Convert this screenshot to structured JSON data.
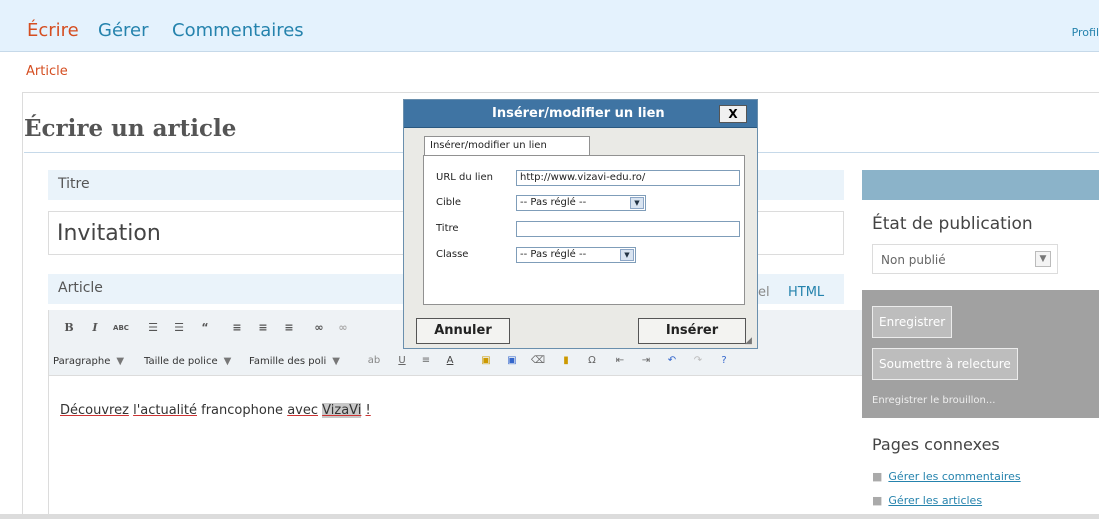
{
  "nav": {
    "tabs": [
      "Écrire",
      "Gérer",
      "Commentaires"
    ],
    "profile_label": "Profil",
    "sub_tab": "Article"
  },
  "page": {
    "title": "Écrire un article"
  },
  "post": {
    "title_label": "Titre",
    "title_value": "Invitation",
    "content_label": "Article",
    "visual_tab_partial": "el",
    "html_tab": "HTML",
    "toolbar": {
      "format_select": "Paragraphe",
      "font_size_select": "Taille de police",
      "font_family_select": "Famille des poli"
    },
    "content": {
      "w1": "Découvrez",
      "w2": "l'actualité",
      "w3": "francophone",
      "w4": "avec",
      "w5": "VizaVi",
      "w6": "!"
    }
  },
  "sidebar": {
    "publish_title": "État de publication",
    "status_select": "Non publié",
    "save_button": "Enregistrer",
    "submit_button": "Soumettre à relecture",
    "draft_text": "Enregistrer le brouillon...",
    "related_title": "Pages connexes",
    "related_links": [
      "Gérer les commentaires",
      "Gérer les articles"
    ]
  },
  "dialog": {
    "title": "Insérer/modifier un lien",
    "close": "X",
    "tab": "Insérer/modifier un lien",
    "url_label": "URL du lien",
    "url_value": "http://www.vizavi-edu.ro/",
    "target_label": "Cible",
    "target_value": "-- Pas réglé --",
    "title_label": "Titre",
    "title_value": "",
    "class_label": "Classe",
    "class_value": "-- Pas réglé --",
    "cancel_button": "Annuler",
    "insert_button": "Insérer"
  },
  "colors": {
    "accent": "#2583ad",
    "active_tab": "#d54e21",
    "dialog_title": "#3f74a3"
  }
}
